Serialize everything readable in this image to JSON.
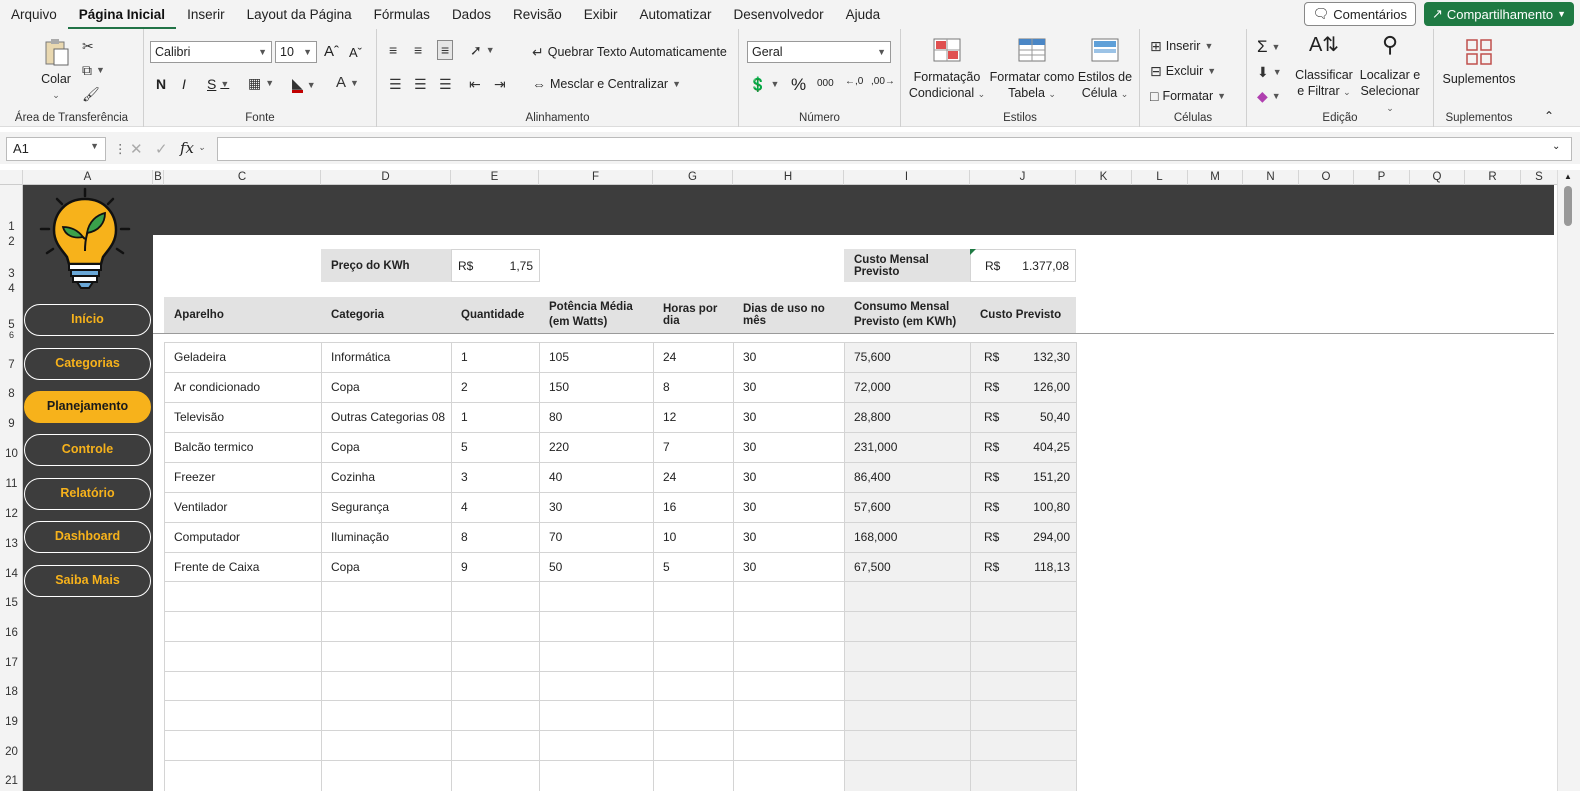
{
  "menu": {
    "items": [
      "Arquivo",
      "Página Inicial",
      "Inserir",
      "Layout da Página",
      "Fórmulas",
      "Dados",
      "Revisão",
      "Exibir",
      "Automatizar",
      "Desenvolvedor",
      "Ajuda"
    ],
    "comments": "Comentários",
    "share": "Compartilhamento"
  },
  "ribbon": {
    "paste": "Colar",
    "clipboard": "Área de Transferência",
    "font_name": "Calibri",
    "font_size": "10",
    "font_group": "Fonte",
    "wrap_text": "Quebrar Texto Automaticamente",
    "merge_center": "Mesclar e Centralizar",
    "alignment_group": "Alinhamento",
    "number_format": "Geral",
    "number_group": "Número",
    "cond_format_1": "Formatação",
    "cond_format_2": "Condicional",
    "format_table_1": "Formatar como",
    "format_table_2": "Tabela",
    "cell_styles_1": "Estilos de",
    "cell_styles_2": "Célula",
    "styles_group": "Estilos",
    "insert": "Inserir",
    "delete": "Excluir",
    "format": "Formatar",
    "cells_group": "Células",
    "sort_filter_1": "Classificar",
    "sort_filter_2": "e Filtrar",
    "find_select_1": "Localizar e",
    "find_select_2": "Selecionar",
    "editing_group": "Edição",
    "addins": "Suplementos",
    "addins_group": "Suplementos"
  },
  "formula_bar": {
    "name_box": "A1",
    "fx": "fx",
    "value": ""
  },
  "columns": [
    "A",
    "B",
    "C",
    "D",
    "E",
    "F",
    "G",
    "H",
    "I",
    "J",
    "K",
    "L",
    "M",
    "N",
    "O",
    "P",
    "Q",
    "R",
    "S"
  ],
  "rows": [
    "1",
    "2",
    "3",
    "4",
    "5",
    "6",
    "7",
    "8",
    "9",
    "10",
    "11",
    "12",
    "13",
    "14",
    "15",
    "16",
    "17",
    "18",
    "19",
    "20",
    "21"
  ],
  "nav": [
    "Início",
    "Categorias",
    "Planejamento",
    "Controle",
    "Relatório",
    "Dashboard",
    "Saiba Mais"
  ],
  "price": {
    "label": "Preço do KWh",
    "currency": "R$",
    "value": "1,75"
  },
  "monthly": {
    "label": "Custo Mensal Previsto",
    "currency": "R$",
    "value": "1.377,08"
  },
  "table": {
    "headers": [
      "Aparelho",
      "Categoria",
      "Quantidade",
      "Potência Média (em Watts)",
      "Horas por dia",
      "Dias de uso no mês",
      "Consumo Mensal Previsto (em KWh)",
      "Custo Previsto"
    ],
    "rows": [
      [
        "Geladeira",
        "Informática",
        "1",
        "105",
        "24",
        "30",
        "75,600",
        "R$",
        "132,30"
      ],
      [
        "Ar condicionado",
        "Copa",
        "2",
        "150",
        "8",
        "30",
        "72,000",
        "R$",
        "126,00"
      ],
      [
        "Televisão",
        "Outras Categorias 08",
        "1",
        "80",
        "12",
        "30",
        "28,800",
        "R$",
        "50,40"
      ],
      [
        "Balcão termico",
        "Copa",
        "5",
        "220",
        "7",
        "30",
        "231,000",
        "R$",
        "404,25"
      ],
      [
        "Freezer",
        "Cozinha",
        "3",
        "40",
        "24",
        "30",
        "86,400",
        "R$",
        "151,20"
      ],
      [
        "Ventilador",
        "Segurança",
        "4",
        "30",
        "16",
        "30",
        "57,600",
        "R$",
        "100,80"
      ],
      [
        "Computador",
        "Iluminação",
        "8",
        "70",
        "10",
        "30",
        "168,000",
        "R$",
        "294,00"
      ],
      [
        "Frente de Caixa",
        "Copa",
        "9",
        "50",
        "5",
        "30",
        "67,500",
        "R$",
        "118,13"
      ]
    ]
  },
  "colors": {
    "accent": "#f7b21b",
    "dark": "#3d3d3d",
    "excel_green": "#1f7a43"
  }
}
